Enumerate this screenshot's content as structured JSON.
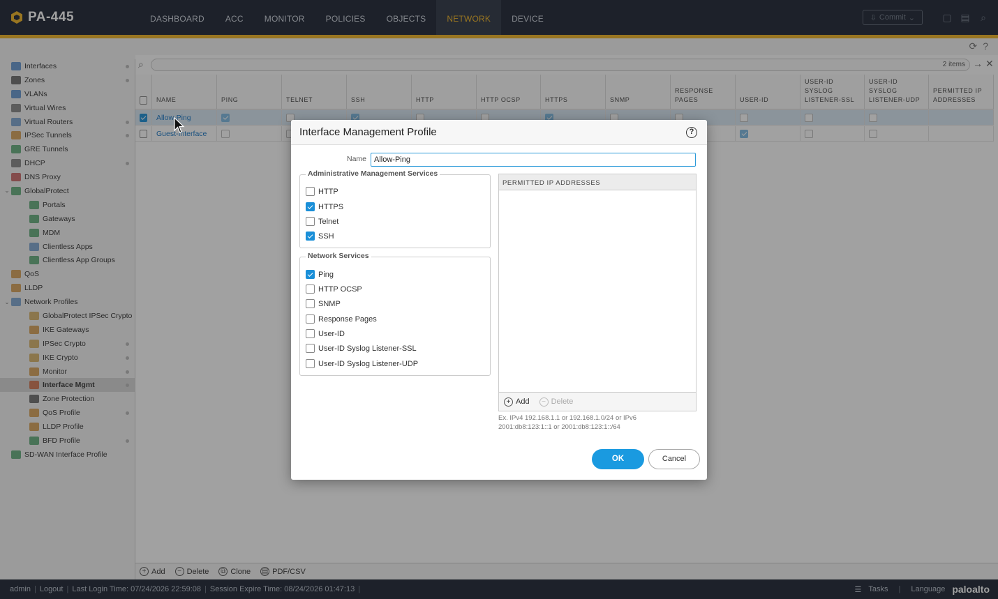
{
  "app": {
    "title": "PA-445"
  },
  "nav": [
    "DASHBOARD",
    "ACC",
    "MONITOR",
    "POLICIES",
    "OBJECTS",
    "NETWORK",
    "DEVICE"
  ],
  "nav_active": "NETWORK",
  "commit_label": "Commit",
  "sidebar": [
    {
      "label": "Interfaces",
      "level": 0,
      "dot": true,
      "color": "#3a7bc8"
    },
    {
      "label": "Zones",
      "level": 0,
      "dot": true,
      "color": "#444"
    },
    {
      "label": "VLANs",
      "level": 0,
      "color": "#3a7bc8"
    },
    {
      "label": "Virtual Wires",
      "level": 0,
      "color": "#666"
    },
    {
      "label": "Virtual Routers",
      "level": 0,
      "dot": true,
      "color": "#5a8fc8"
    },
    {
      "label": "IPSec Tunnels",
      "level": 0,
      "dot": true,
      "color": "#d08a2a"
    },
    {
      "label": "GRE Tunnels",
      "level": 0,
      "color": "#3a9a5a"
    },
    {
      "label": "DHCP",
      "level": 0,
      "dot": true,
      "color": "#666"
    },
    {
      "label": "DNS Proxy",
      "level": 0,
      "color": "#c04040"
    },
    {
      "label": "GlobalProtect",
      "level": 0,
      "caret": true,
      "color": "#3a9a5a"
    },
    {
      "label": "Portals",
      "level": 1,
      "color": "#3a9a5a"
    },
    {
      "label": "Gateways",
      "level": 1,
      "color": "#3a9a5a"
    },
    {
      "label": "MDM",
      "level": 1,
      "color": "#3a9a5a"
    },
    {
      "label": "Clientless Apps",
      "level": 1,
      "color": "#5a8fc8"
    },
    {
      "label": "Clientless App Groups",
      "level": 1,
      "color": "#3a9a5a"
    },
    {
      "label": "QoS",
      "level": 0,
      "color": "#d08a2a"
    },
    {
      "label": "LLDP",
      "level": 0,
      "color": "#d08a2a"
    },
    {
      "label": "Network Profiles",
      "level": 0,
      "caret": true,
      "color": "#5a8fc8"
    },
    {
      "label": "GlobalProtect IPSec Crypto",
      "level": 1,
      "color": "#d0a040"
    },
    {
      "label": "IKE Gateways",
      "level": 1,
      "color": "#d08a2a"
    },
    {
      "label": "IPSec Crypto",
      "level": 1,
      "dot": true,
      "color": "#d0a040"
    },
    {
      "label": "IKE Crypto",
      "level": 1,
      "dot": true,
      "color": "#d0a040"
    },
    {
      "label": "Monitor",
      "level": 1,
      "dot": true,
      "color": "#d08a2a"
    },
    {
      "label": "Interface Mgmt",
      "level": 1,
      "dot": true,
      "active": true,
      "color": "#d05a2a"
    },
    {
      "label": "Zone Protection",
      "level": 1,
      "color": "#444"
    },
    {
      "label": "QoS Profile",
      "level": 1,
      "dot": true,
      "color": "#d08a2a"
    },
    {
      "label": "LLDP Profile",
      "level": 1,
      "color": "#d08a2a"
    },
    {
      "label": "BFD Profile",
      "level": 1,
      "dot": true,
      "color": "#3a9a5a"
    },
    {
      "label": "SD-WAN Interface Profile",
      "level": 0,
      "color": "#3a9a5a"
    }
  ],
  "grid": {
    "item_count": "2 items",
    "columns": [
      "NAME",
      "PING",
      "TELNET",
      "SSH",
      "HTTP",
      "HTTP OCSP",
      "HTTPS",
      "SNMP",
      "RESPONSE PAGES",
      "USER-ID",
      "USER-ID SYSLOG LISTENER-SSL",
      "USER-ID SYSLOG LISTENER-UDP",
      "PERMITTED IP ADDRESSES"
    ],
    "rows": [
      {
        "name": "Allow-Ping",
        "selected": true,
        "flags": [
          true,
          false,
          true,
          false,
          false,
          true,
          false,
          false,
          false,
          false,
          false
        ]
      },
      {
        "name": "Guest-Interface",
        "selected": false,
        "flags": [
          false,
          false,
          false,
          false,
          false,
          false,
          false,
          false,
          true,
          false,
          false
        ]
      }
    ]
  },
  "bottom_actions": [
    "Add",
    "Delete",
    "Clone",
    "PDF/CSV"
  ],
  "status": {
    "user": "admin",
    "logout": "Logout",
    "last_login": "Last Login Time: 07/24/2026 22:59:08",
    "session": "Session Expire Time: 08/24/2026 01:47:13",
    "tasks": "Tasks",
    "language": "Language",
    "brand": "paloalto"
  },
  "dialog": {
    "title": "Interface Management Profile",
    "name_label": "Name",
    "name_value": "Allow-Ping",
    "admin_legend": "Administrative Management Services",
    "admin_services": [
      {
        "label": "HTTP",
        "checked": false
      },
      {
        "label": "HTTPS",
        "checked": true
      },
      {
        "label": "Telnet",
        "checked": false
      },
      {
        "label": "SSH",
        "checked": true
      }
    ],
    "network_legend": "Network Services",
    "network_services": [
      {
        "label": "Ping",
        "checked": true
      },
      {
        "label": "HTTP OCSP",
        "checked": false
      },
      {
        "label": "SNMP",
        "checked": false
      },
      {
        "label": "Response Pages",
        "checked": false
      },
      {
        "label": "User-ID",
        "checked": false
      },
      {
        "label": "User-ID Syslog Listener-SSL",
        "checked": false
      },
      {
        "label": "User-ID Syslog Listener-UDP",
        "checked": false
      }
    ],
    "permitted_header": "PERMITTED IP ADDRESSES",
    "add_label": "Add",
    "delete_label": "Delete",
    "hint_line1": "Ex. IPv4 192.168.1.1 or 192.168.1.0/24 or IPv6",
    "hint_line2": "2001:db8:123:1::1 or 2001:db8:123:1::/64",
    "ok_label": "OK",
    "cancel_label": "Cancel"
  }
}
